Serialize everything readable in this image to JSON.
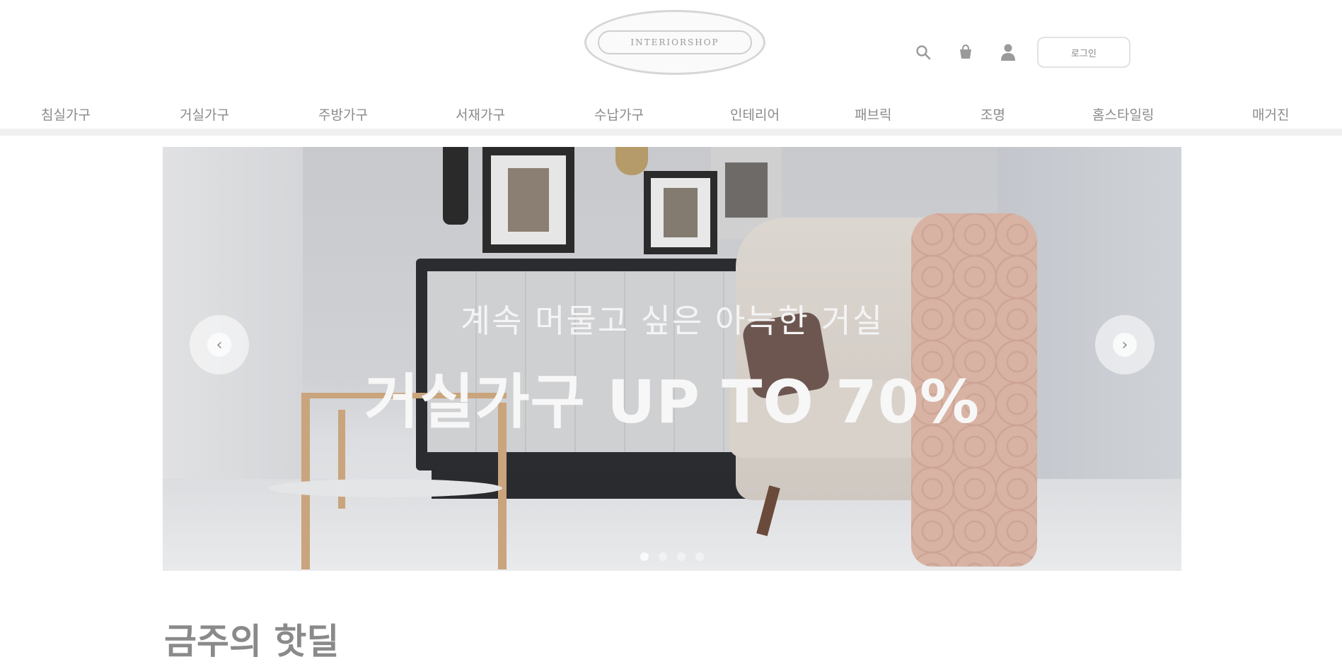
{
  "header": {
    "logo_text": "INTERIORSHOP",
    "icons": [
      "search-icon",
      "cart-icon",
      "user-icon"
    ],
    "login_label": "로그인"
  },
  "nav": {
    "items": [
      "침실가구",
      "거실가구",
      "주방가구",
      "서재가구",
      "수납가구",
      "인테리어",
      "패브릭",
      "조명",
      "홈스타일링",
      "매거진"
    ]
  },
  "banner": {
    "subtitle": "계속 머물고 싶은 아늑한 거실",
    "title": "거실가구 UP TO 70%",
    "prev_icon": "chevron-left-icon",
    "next_icon": "chevron-right-icon",
    "slides": 4,
    "active_slide": 1
  },
  "section": {
    "title": "금주의 핫딜"
  }
}
